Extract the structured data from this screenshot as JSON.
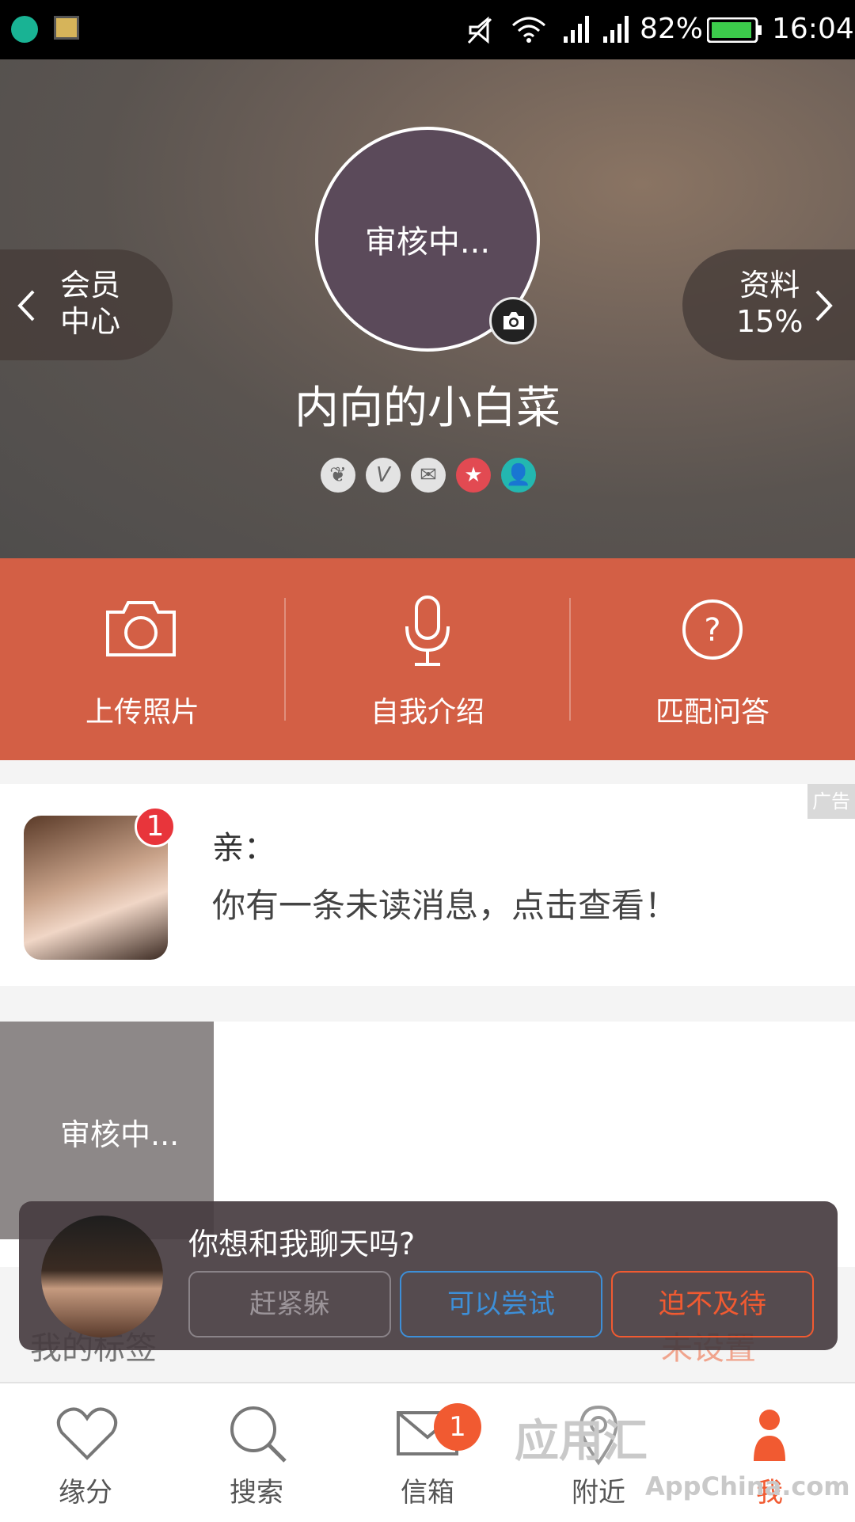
{
  "status_bar": {
    "battery": "82%",
    "time": "16:04"
  },
  "header": {
    "avatar_status": "审核中...",
    "username": "内向的小白菜",
    "member_center": [
      "会员",
      "中心"
    ],
    "profile": {
      "label": "资料",
      "percent": "15%"
    }
  },
  "actions": [
    {
      "label": "上传照片",
      "icon": "camera-icon"
    },
    {
      "label": "自我介绍",
      "icon": "microphone-icon"
    },
    {
      "label": "匹配问答",
      "icon": "question-icon"
    }
  ],
  "message_card": {
    "ad_label": "广告",
    "unread_count": "1",
    "title": "亲：",
    "text": "你有一条未读消息，点击查看！"
  },
  "cover": {
    "status": "审核中..."
  },
  "tags": {
    "label": "我的标签",
    "value": "未设置"
  },
  "chat_popup": {
    "question": "你想和我聊天吗?",
    "buttons": [
      "赶紧躲",
      "可以尝试",
      "迫不及待"
    ]
  },
  "bottom_nav": {
    "items": [
      "缘分",
      "搜索",
      "信箱",
      "附近",
      "我"
    ],
    "mail_badge": "1"
  },
  "watermark": {
    "main": "应用汇",
    "sub": "AppChina.com"
  },
  "colors": {
    "accent": "#d35f45",
    "badge": "#e8353b",
    "try_button": "#3d8fd8",
    "eager_button": "#f15a31"
  }
}
